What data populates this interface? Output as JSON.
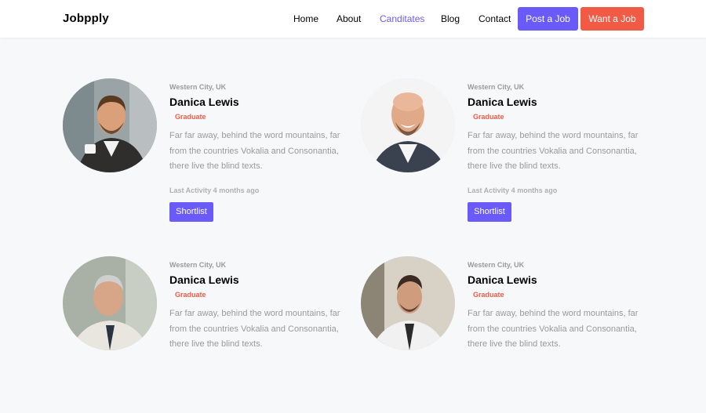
{
  "header": {
    "logo": "Jobpply",
    "nav": [
      "Home",
      "About",
      "Canditates",
      "Blog",
      "Contact"
    ],
    "active_nav": "Canditates",
    "post_job": "Post a Job",
    "want_job": "Want a Job"
  },
  "colors": {
    "accent_purple": "#6a5af9",
    "accent_orange": "#f15b46",
    "page_bg": "#f7f8fa"
  },
  "candidates": [
    {
      "location": "Western City, UK",
      "name": "Danica Lewis",
      "badge": "Graduate",
      "description": "Far far away, behind the word mountains, far from the countries Vokalia and Consonantia, there live the blind texts.",
      "activity": "Last Activity 4 months ago",
      "button": "Shortlist",
      "photo": "smiling-man-holding-cup-photo"
    },
    {
      "location": "Western City, UK",
      "name": "Danica Lewis",
      "badge": "Graduate",
      "description": "Far far away, behind the word mountains, far from the countries Vokalia and Consonantia, there live the blind texts.",
      "activity": "Last Activity 4 months ago",
      "button": "Shortlist",
      "photo": "laughing-bald-man-photo"
    },
    {
      "location": "Western City, UK",
      "name": "Danica Lewis",
      "badge": "Graduate",
      "description": "Far far away, behind the word mountains, far from the countries Vokalia and Consonantia, there live the blind texts.",
      "photo": "older-man-in-tie-photo"
    },
    {
      "location": "Western City, UK",
      "name": "Danica Lewis",
      "badge": "Graduate",
      "description": "Far far away, behind the word mountains, far from the countries Vokalia and Consonantia, there live the blind texts.",
      "photo": "young-man-in-shirt-photo"
    }
  ]
}
